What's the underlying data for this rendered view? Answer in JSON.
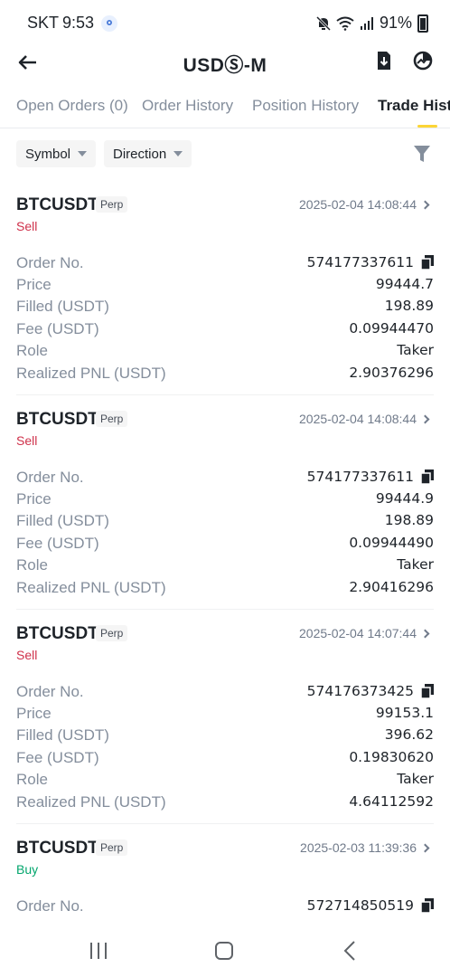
{
  "status_bar": {
    "carrier": "SKT",
    "time": "9:53",
    "battery": "91%"
  },
  "header": {
    "title": "USDⓈ-M"
  },
  "tabs": [
    {
      "label": "Open Orders (0)",
      "active": false
    },
    {
      "label": "Order History",
      "active": false
    },
    {
      "label": "Position History",
      "active": false
    },
    {
      "label": "Trade History",
      "active": true
    }
  ],
  "filters": {
    "symbol_label": "Symbol",
    "direction_label": "Direction"
  },
  "labels": {
    "order_no": "Order No.",
    "price": "Price",
    "filled": "Filled (USDT)",
    "fee": "Fee (USDT)",
    "role": "Role",
    "pnl": "Realized PNL (USDT)"
  },
  "trades": [
    {
      "symbol": "BTCUSDT",
      "badge": "Perp",
      "side": "Sell",
      "time": "2025-02-04 14:08:44",
      "order_no": "574177337611",
      "price": "99444.7",
      "filled": "198.89",
      "fee": "0.09944470",
      "role": "Taker",
      "pnl": "2.90376296"
    },
    {
      "symbol": "BTCUSDT",
      "badge": "Perp",
      "side": "Sell",
      "time": "2025-02-04 14:08:44",
      "order_no": "574177337611",
      "price": "99444.9",
      "filled": "198.89",
      "fee": "0.09944490",
      "role": "Taker",
      "pnl": "2.90416296"
    },
    {
      "symbol": "BTCUSDT",
      "badge": "Perp",
      "side": "Sell",
      "time": "2025-02-04 14:07:44",
      "order_no": "574176373425",
      "price": "99153.1",
      "filled": "396.62",
      "fee": "0.19830620",
      "role": "Taker",
      "pnl": "4.64112592"
    },
    {
      "symbol": "BTCUSDT",
      "badge": "Perp",
      "side": "Buy",
      "time": "2025-02-03 11:39:36",
      "order_no": "572714850519"
    }
  ],
  "colors": {
    "sell": "#cf304a",
    "buy": "#03a66d",
    "accent": "#fcd535"
  }
}
